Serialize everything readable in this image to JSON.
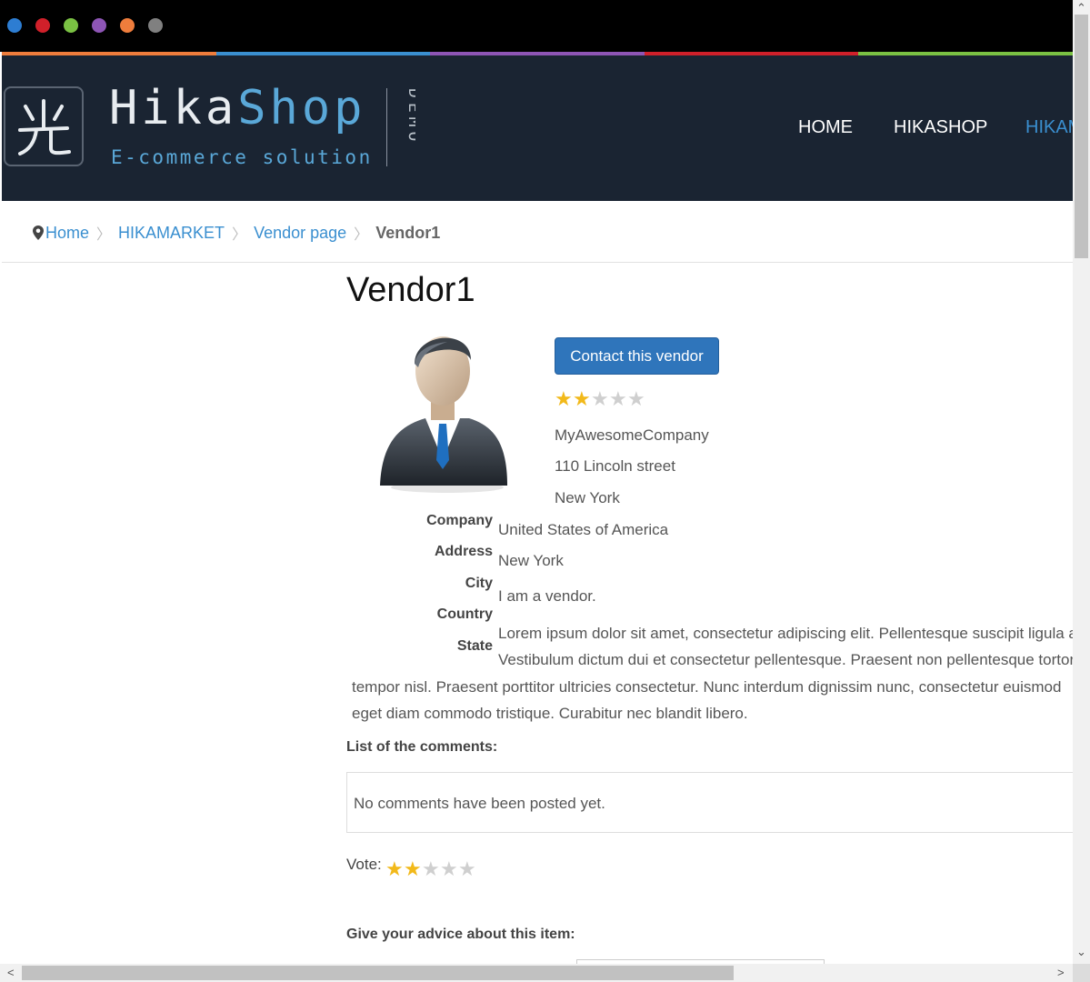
{
  "window": {
    "dots": [
      "#2d7dd2",
      "#d0202a",
      "#7ac143",
      "#8e55b5",
      "#ef7d3c",
      "#808080"
    ],
    "strip_colors": [
      "#ef7d3c",
      "#3a8fd0",
      "#8e55b5",
      "#d0202a",
      "#7ac143"
    ]
  },
  "header": {
    "logo_hika": "Hika",
    "logo_shop": "Shop",
    "logo_sub": "E-commerce solution",
    "logo_demo": "DEMO",
    "nav": [
      {
        "label": "HOME",
        "color": "#ffffff"
      },
      {
        "label": "HIKASHOP",
        "color": "#ffffff"
      },
      {
        "label": "HIKAM",
        "color": "#3a8fd0"
      }
    ]
  },
  "breadcrumb": {
    "items": [
      "Home",
      "HIKAMARKET",
      "Vendor page"
    ],
    "current": "Vendor1"
  },
  "vendor": {
    "title": "Vendor1",
    "contact_button": "Contact this vendor",
    "rating": 2,
    "rating_max": 5,
    "info_lines": [
      "MyAwesomeCompany",
      "110 Lincoln street",
      "New York"
    ],
    "labels": [
      "Company",
      "Address",
      "City",
      "Country",
      "State"
    ],
    "values": [
      "United States of America",
      "New York",
      "I am a vendor."
    ],
    "desc_lines": [
      "Lorem ipsum dolor sit amet, consectetur adipiscing elit. Pellentesque suscipit ligula a",
      "Vestibulum dictum dui et consectetur pellentesque. Praesent non pellentesque tortor",
      "tempor nisl. Praesent porttitor ultricies consectetur. Nunc interdum dignissim nunc, consectetur euismod",
      "eget diam commodo tristique. Curabitur nec blandit libero."
    ]
  },
  "comments": {
    "heading": "List of the comments:",
    "empty_text": "No comments have been posted yet.",
    "vote_label": "Vote:",
    "vote_rating": 2,
    "advice_heading": "Give your advice about this item:"
  },
  "scrollbars": {
    "up": "⌃",
    "down": "⌄",
    "left": "<",
    "right": ">"
  }
}
